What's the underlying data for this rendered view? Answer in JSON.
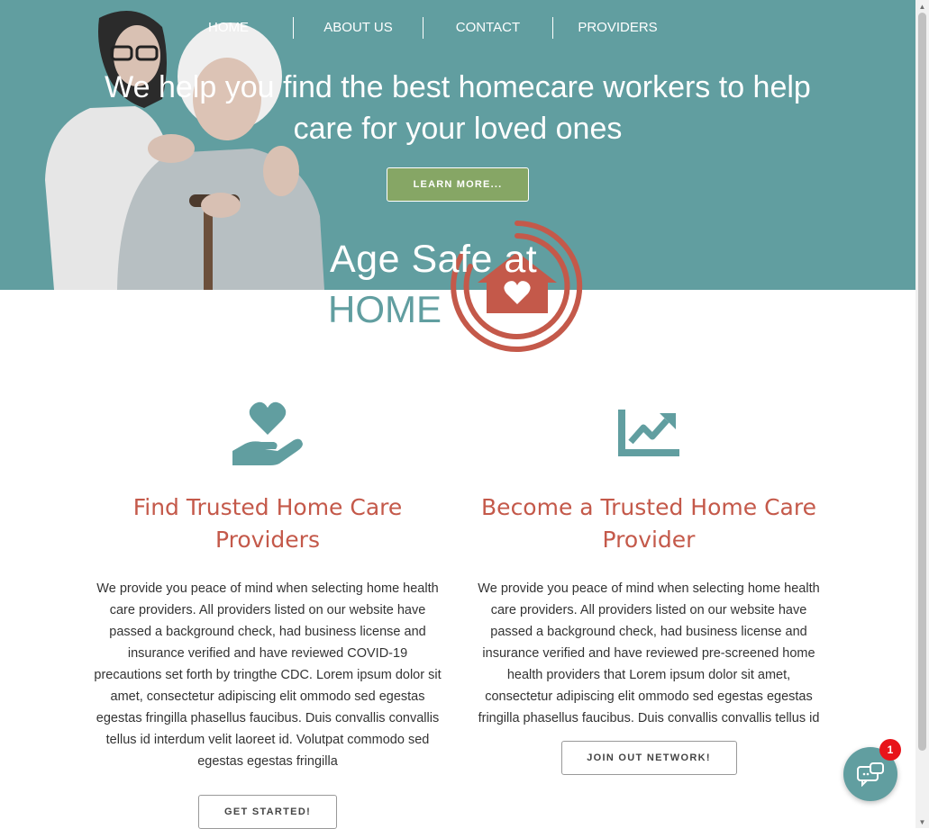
{
  "nav": {
    "items": [
      {
        "label": "HOME"
      },
      {
        "label": "ABOUT US"
      },
      {
        "label": "CONTACT"
      },
      {
        "label": "PROVIDERS"
      }
    ]
  },
  "hero": {
    "headline": "We help you find the best homecare workers to help care for your loved ones",
    "button_label": "LEARN MORE...",
    "photo_icon": "caregiver-with-senior-photo",
    "background_color": "#619ea0",
    "button_color": "#86a665"
  },
  "logo": {
    "line1": "Age Safe at",
    "line2": "HOME",
    "mark_icon": "house-heart-circle-icon",
    "accent_color": "#c4594a"
  },
  "columns": [
    {
      "icon": "heart-in-hand-icon",
      "title": "Find Trusted Home Care Providers",
      "body": "We provide you peace of mind when selecting home health care providers. All providers listed on our website have passed a background check, had business license and insurance verified and have reviewed COVID-19 precautions set forth by tringthe CDC. Lorem ipsum dolor sit amet, consectetur adipiscing elit ommodo sed egestas egestas fringilla phasellus faucibus. Duis convallis convallis tellus id interdum velit laoreet id. Volutpat commodo sed egestas egestas fringilla",
      "button_label": "GET STARTED!"
    },
    {
      "icon": "chart-line-up-icon",
      "title": "Become a Trusted Home Care Provider",
      "body": "We provide you peace of mind when selecting home health care providers. All providers listed on our website have passed a background check, had business license and insurance verified and have reviewed pre-screened home health providers that Lorem ipsum dolor sit amet, consectetur adipiscing elit ommodo sed egestas egestas fringilla phasellus faucibus. Duis convallis convallis tellus id",
      "button_label": "JOIN OUT NETWORK!"
    }
  ],
  "chat": {
    "badge_count": "1",
    "icon": "chat-bubbles-icon"
  }
}
